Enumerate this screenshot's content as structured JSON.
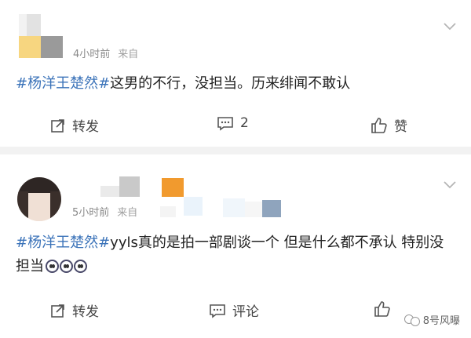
{
  "posts": [
    {
      "time": "4小时前",
      "source": "来自",
      "tag": "#杨洋王楚然#",
      "text": "这男的不行，没担当。历来绯闻不敢认",
      "actions": {
        "share": "转发",
        "comment": "2",
        "like": "赞"
      }
    },
    {
      "time": "5小时前",
      "source": "来自",
      "tag": "#杨洋王楚然#",
      "text": "yyls真的是拍一部剧谈一个 但是什么都不承认 特别没担当",
      "actions": {
        "share": "转发",
        "comment": "评论",
        "like": ""
      }
    }
  ],
  "watermark": "8号风曝",
  "icons": {
    "expand": "chevron-down-icon",
    "share": "share-icon",
    "comment": "comment-icon",
    "like": "thumbs-up-icon",
    "emoji": "face-emoji"
  },
  "colors": {
    "tag": "#3b73b9",
    "background": "#f2f2f2",
    "card": "#ffffff"
  }
}
